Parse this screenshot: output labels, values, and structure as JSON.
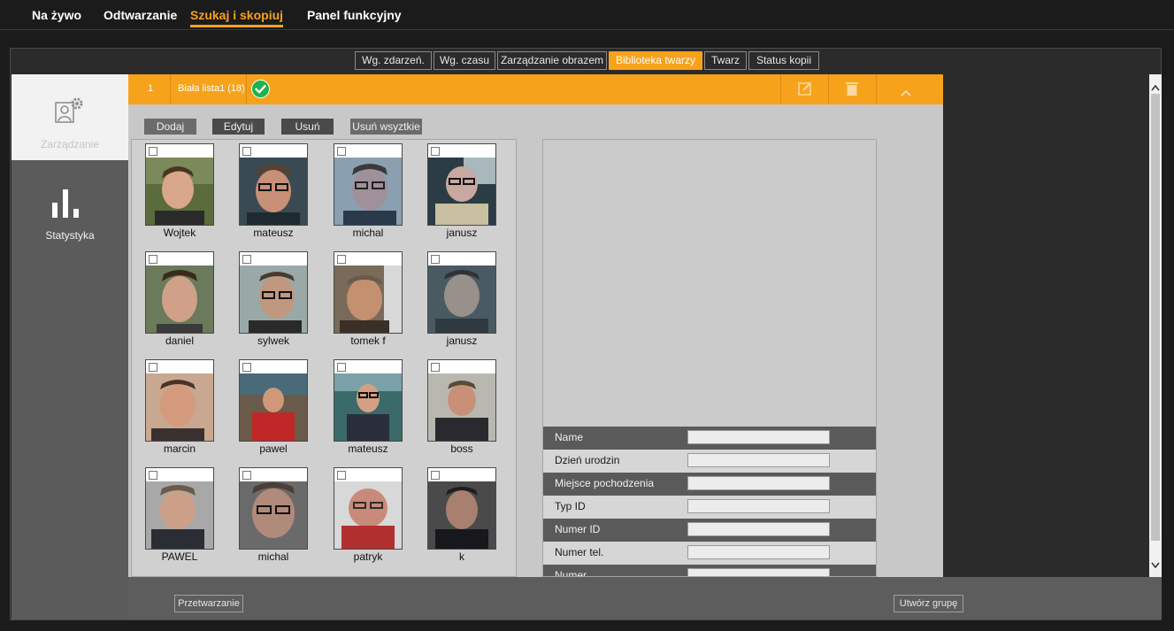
{
  "nav": {
    "items": [
      {
        "label": "Na żywo",
        "active": false
      },
      {
        "label": "Odtwarzanie",
        "active": false
      },
      {
        "label": "Szukaj i skopiuj",
        "active": true
      },
      {
        "label": "Panel funkcyjny",
        "active": false
      }
    ]
  },
  "subtabs": [
    {
      "label": "Wg. zdarzeń.",
      "active": false
    },
    {
      "label": "Wg. czasu",
      "active": false
    },
    {
      "label": "Zarządzanie obrazem",
      "active": false
    },
    {
      "label": "Biblioteka twarzy",
      "active": true
    },
    {
      "label": "Twarz",
      "active": false
    },
    {
      "label": "Status kopii",
      "active": false
    }
  ],
  "sidebar": {
    "items": [
      {
        "label": "Zarządzanie",
        "icon": "face-settings-icon",
        "active": true
      },
      {
        "label": "Statystyka",
        "icon": "bar-chart-icon",
        "active": false
      }
    ]
  },
  "group": {
    "index": "1",
    "name": "Biała lista1 (18)",
    "status_icon": "check-circle-icon",
    "icons": [
      "edit-icon",
      "delete-icon",
      "collapse-icon"
    ]
  },
  "actions": {
    "add": "Dodaj",
    "edit": "Edytuj",
    "delete": "Usuń",
    "delete_all": "Usuń wsyztkie"
  },
  "faces": [
    {
      "name": "Wojtek"
    },
    {
      "name": "mateusz"
    },
    {
      "name": "michal"
    },
    {
      "name": "janusz"
    },
    {
      "name": "daniel"
    },
    {
      "name": "sylwek"
    },
    {
      "name": "tomek f"
    },
    {
      "name": "janusz"
    },
    {
      "name": "marcin"
    },
    {
      "name": "pawel"
    },
    {
      "name": "mateusz"
    },
    {
      "name": "boss"
    },
    {
      "name": "PAWEL"
    },
    {
      "name": "michal"
    },
    {
      "name": "patryk"
    },
    {
      "name": "k"
    }
  ],
  "details": {
    "fields": [
      {
        "label": "Name",
        "value": ""
      },
      {
        "label": "Dzień urodzin",
        "value": ""
      },
      {
        "label": "Miejsce pochodzenia",
        "value": ""
      },
      {
        "label": "Typ ID",
        "value": ""
      },
      {
        "label": "Numer ID",
        "value": ""
      },
      {
        "label": "Numer tel.",
        "value": ""
      },
      {
        "label": "Numer",
        "value": ""
      }
    ]
  },
  "bottom": {
    "process": "Przetwarzanie",
    "create_group": "Utwórz grupę"
  },
  "colors": {
    "accent": "#f7a21b",
    "success": "#22b14c"
  }
}
